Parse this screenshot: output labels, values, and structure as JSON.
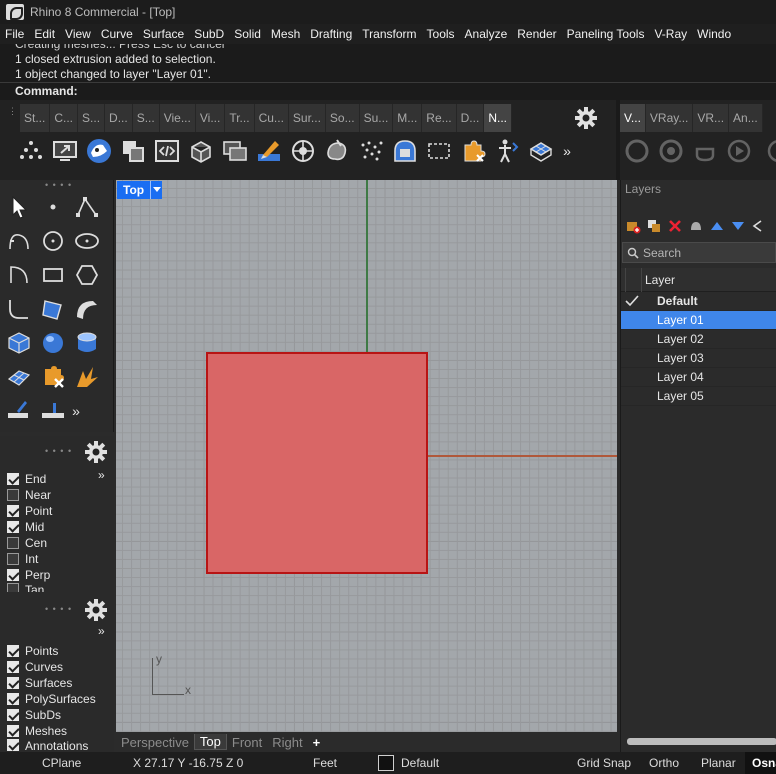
{
  "window": {
    "title": "Rhino 8 Commercial - [Top]"
  },
  "menu": [
    "File",
    "Edit",
    "View",
    "Curve",
    "Surface",
    "SubD",
    "Solid",
    "Mesh",
    "Drafting",
    "Transform",
    "Tools",
    "Analyze",
    "Render",
    "Paneling Tools",
    "V-Ray",
    "Windo"
  ],
  "history": [
    "Creating meshes... Press Esc to cancel",
    "1 closed extrusion added to selection.",
    "1 object changed to layer \"Layer 01\"."
  ],
  "command": {
    "label": "Command:"
  },
  "toolbar_tabs": [
    "St...",
    "C...",
    "S...",
    "D...",
    "S...",
    "Vie...",
    "Vi...",
    "Tr...",
    "Cu...",
    "Sur...",
    "So...",
    "Su...",
    "M...",
    "Re...",
    "D...",
    "N..."
  ],
  "vray_tabs": [
    "V...",
    "VRay...",
    "VR...",
    "An..."
  ],
  "more_glyph": "»",
  "osnap": [
    {
      "label": "End",
      "checked": true
    },
    {
      "label": "Near",
      "checked": false
    },
    {
      "label": "Point",
      "checked": true
    },
    {
      "label": "Mid",
      "checked": true
    },
    {
      "label": "Cen",
      "checked": false
    },
    {
      "label": "Int",
      "checked": false
    },
    {
      "label": "Perp",
      "checked": true
    },
    {
      "label": "Tan",
      "checked": false
    }
  ],
  "visibility": [
    {
      "label": "Points",
      "checked": true
    },
    {
      "label": "Curves",
      "checked": true
    },
    {
      "label": "Surfaces",
      "checked": true
    },
    {
      "label": "PolySurfaces",
      "checked": true
    },
    {
      "label": "SubDs",
      "checked": true
    },
    {
      "label": "Meshes",
      "checked": true
    },
    {
      "label": "Annotations",
      "checked": true
    }
  ],
  "viewport": {
    "name": "Top",
    "axis_x": "x",
    "axis_y": "y",
    "tabs": [
      "Perspective",
      "Top",
      "Front",
      "Right"
    ],
    "active_tab": "Top",
    "add_glyph": "+"
  },
  "layers": {
    "title": "Layers",
    "search_placeholder": "Search",
    "column": "Layer",
    "rows": [
      {
        "name": "Default",
        "current": true
      },
      {
        "name": "Layer 01",
        "selected": true
      },
      {
        "name": "Layer 02"
      },
      {
        "name": "Layer 03"
      },
      {
        "name": "Layer 04"
      },
      {
        "name": "Layer 05"
      }
    ]
  },
  "status": {
    "cplane": "CPlane",
    "coords": "X 27.17 Y -16.75 Z 0",
    "units": "Feet",
    "layer": "Default",
    "grid_snap": "Grid Snap",
    "ortho": "Ortho",
    "planar": "Planar",
    "osnap": "Osna"
  },
  "colors": {
    "selection_fill": "#d96666",
    "selection_stroke": "#b81414",
    "accent": "#3f86ea"
  }
}
